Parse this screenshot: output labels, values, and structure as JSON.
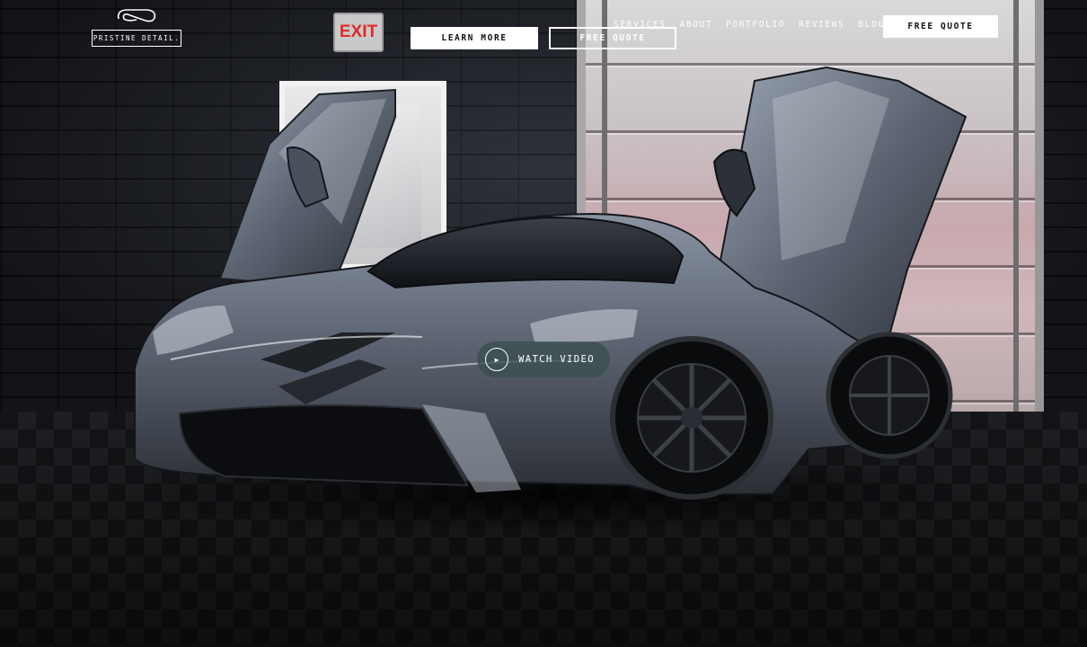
{
  "brand": {
    "name": "PRISTINE DETAIL."
  },
  "hero": {
    "sign_text": "EXIT",
    "buttons": {
      "learn_more": "LEARN MORE",
      "free_quote": "FREE QUOTE"
    },
    "video": {
      "label": "WATCH VIDEO",
      "icon": "play-icon"
    }
  },
  "nav": {
    "items": [
      "SERVICES",
      "ABOUT",
      "PORTFOLIO",
      "REVIEWS",
      "BLOG"
    ],
    "cta_label": "FREE QUOTE"
  },
  "colors": {
    "accent": "#ffffff",
    "exit_sign_red": "#e02a2a",
    "video_pill": "#3a4e50"
  }
}
